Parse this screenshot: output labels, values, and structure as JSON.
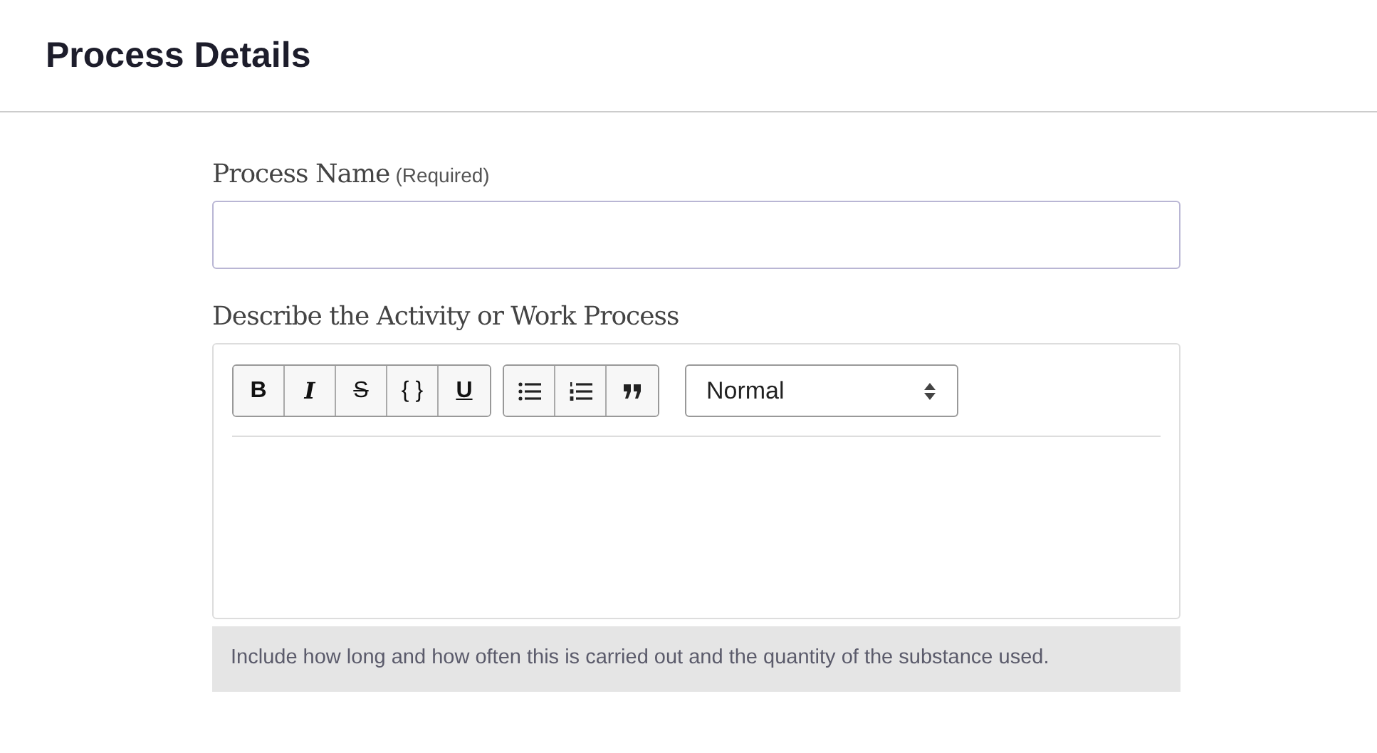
{
  "header": {
    "title": "Process Details"
  },
  "name_field": {
    "label": "Process Name",
    "note": "(Required)"
  },
  "description": {
    "label": "Describe the Activity or Work Process",
    "toolbar_groups": [
      [
        {
          "kind": "bold",
          "label": "B"
        },
        {
          "kind": "italic",
          "label": "I"
        },
        {
          "kind": "strike",
          "label": "S"
        },
        {
          "kind": "code",
          "label": "{ }"
        },
        {
          "kind": "underline",
          "label": "U"
        }
      ],
      [
        {
          "kind": "bullet-list"
        },
        {
          "kind": "numbered-list"
        },
        {
          "kind": "quote"
        }
      ]
    ],
    "block_format": "Normal",
    "hint": "Include how long and how often this is carried out and the quantity of the substance used."
  }
}
